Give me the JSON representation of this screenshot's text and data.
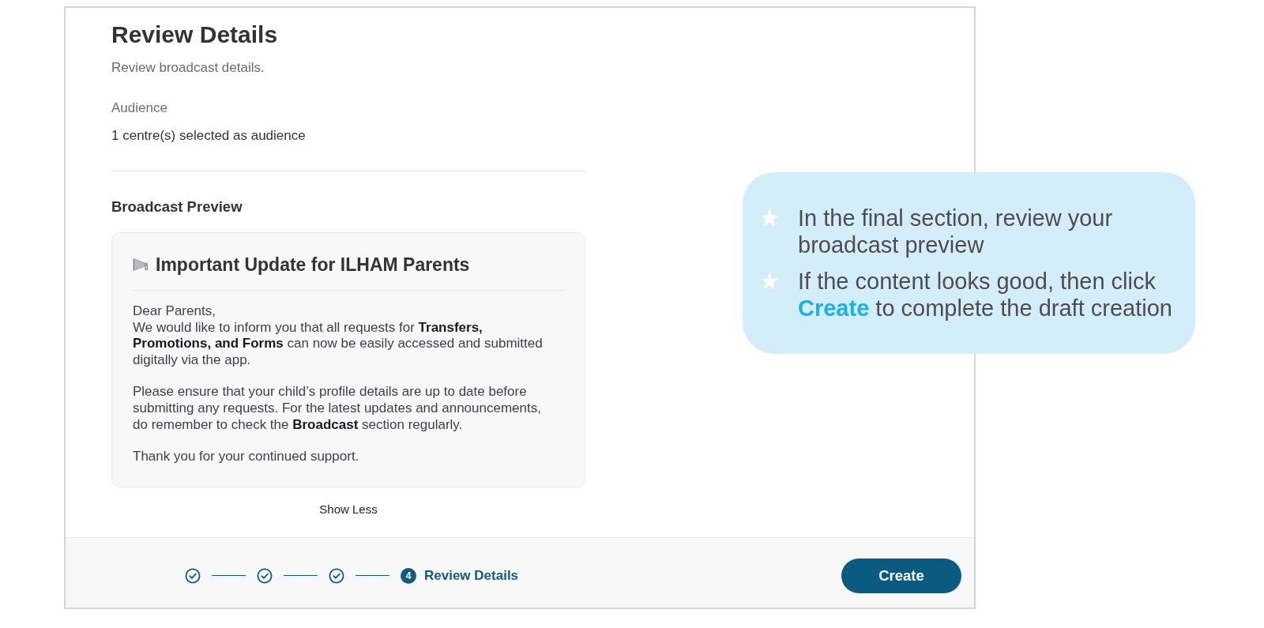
{
  "header": {
    "title": "Review Details",
    "subtitle": "Review broadcast details."
  },
  "audience": {
    "label": "Audience",
    "value": "1 centre(s) selected as audience"
  },
  "preview": {
    "heading": "Broadcast Preview",
    "title": "Important Update for ILHAM Parents",
    "greeting": "Dear Parents,",
    "paragraphs": [
      "We would like to inform you that all requests for **Transfers, Promotions, and Forms** can now be easily accessed and submitted digitally via the app.",
      "Please ensure that your child’s profile details are up to date before submitting any requests. For the latest updates and announcements, do remember to check the **Broadcast** section regularly.",
      "Thank you for your continued support."
    ],
    "toggle": "Show Less"
  },
  "stepper": {
    "steps": [
      {
        "completed": true
      },
      {
        "completed": true
      },
      {
        "completed": true
      },
      {
        "completed": false,
        "number": "4",
        "label": "Review Details"
      }
    ]
  },
  "actions": {
    "create": "Create"
  },
  "callout": {
    "items": [
      "In the final section, review your broadcast preview",
      "If the content looks good, then click **Create** to complete the draft creation"
    ]
  }
}
